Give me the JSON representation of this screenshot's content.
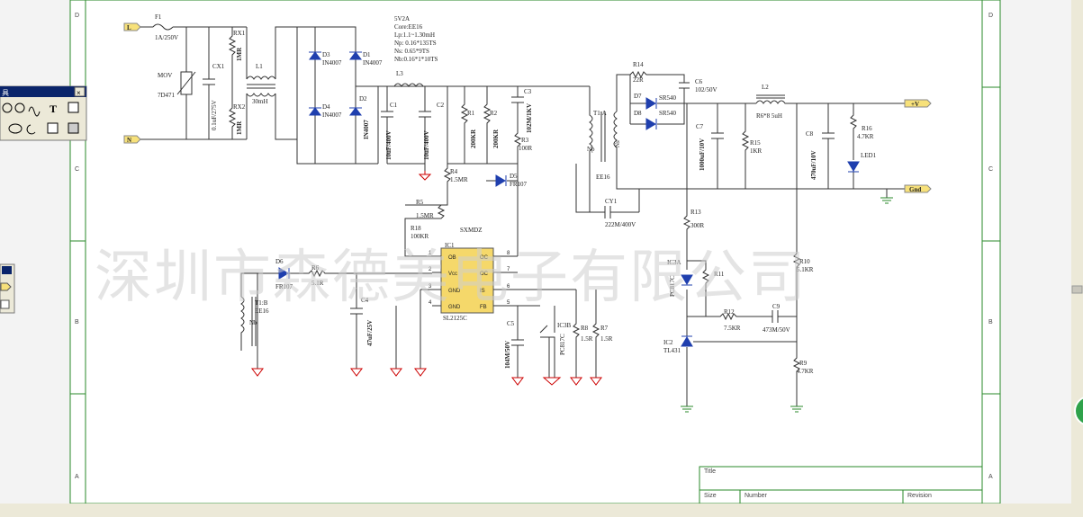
{
  "watermark": "深圳市森德美电子有限公司",
  "border_zones": {
    "left": [
      "D",
      "C",
      "B",
      "A"
    ],
    "right": [
      "D",
      "C",
      "B",
      "A"
    ]
  },
  "title_block": {
    "title_label": "Title",
    "size_label": "Size",
    "number_label": "Number",
    "revision_label": "Revision"
  },
  "toolbox": {
    "title": "具",
    "close": "×"
  },
  "nets": {
    "line": "L",
    "neutral": "N",
    "vout": "+V",
    "gnd": "Gnd"
  },
  "components": {
    "F1": [
      "F1",
      "1A/250V"
    ],
    "MOV": [
      "MOV",
      "7D471"
    ],
    "CX1": [
      "CX1",
      "0.1uF/275V"
    ],
    "RX1": [
      "RX1",
      "1MR"
    ],
    "RX2": [
      "RX2",
      "1MR"
    ],
    "L1": [
      "L1",
      "30mH"
    ],
    "D3": [
      "D3",
      "IN4007"
    ],
    "D1": [
      "D1",
      "IN4007"
    ],
    "D4": [
      "D4",
      "IN4007"
    ],
    "D2": [
      "D2",
      "IN4007"
    ],
    "C1": [
      "C1",
      "10uF/400V"
    ],
    "C2": [
      "C2",
      "10uF/400V"
    ],
    "L3": [
      "L3"
    ],
    "R1": [
      "R1",
      "200KR"
    ],
    "R2": [
      "R2",
      "200KR"
    ],
    "C3": [
      "C3",
      "102M/1KV"
    ],
    "R3": [
      "R3",
      "100R"
    ],
    "D5": [
      "D5",
      "FR107"
    ],
    "R4": [
      "R4",
      "1.5MR"
    ],
    "R5": [
      "R5",
      "1.5MR"
    ],
    "R18": [
      "R18",
      "100KR"
    ],
    "T1A": [
      "T1:A",
      "Np",
      "Ns",
      "EE16"
    ],
    "R14": [
      "R14",
      "22R"
    ],
    "C6": [
      "C6",
      "102/50V"
    ],
    "D7": [
      "D7",
      "SR540"
    ],
    "D8": [
      "D8",
      "SR540"
    ],
    "C7": [
      "C7",
      "1000uF/10V"
    ],
    "R15": [
      "R15",
      "1KR"
    ],
    "L2": [
      "L2",
      "R6*8 5uH"
    ],
    "C8": [
      "C8",
      "470uF/10V"
    ],
    "R16": [
      "R16",
      "4.7KR"
    ],
    "LED1": [
      "LED1"
    ],
    "CY1": [
      "CY1",
      "222M/400V"
    ],
    "R13": [
      "R13",
      "300R"
    ],
    "IC3A": [
      "IC3A",
      "PC817C"
    ],
    "R11": [
      "R11"
    ],
    "R10": [
      "R10",
      "5.1KR"
    ],
    "R12": [
      "R12",
      "7.5KR"
    ],
    "C9": [
      "C9",
      "473M/50V"
    ],
    "IC2": [
      "IC2",
      "TL431"
    ],
    "R9": [
      "R9",
      "4.7KR"
    ],
    "D6": [
      "D6",
      "FR107"
    ],
    "R6": [
      "R6",
      "5.1R"
    ],
    "T1B": [
      "T1:B",
      "EE16",
      "Nb"
    ],
    "C4": [
      "C4",
      "47uF/25V"
    ],
    "C5": [
      "C5",
      "104M/50V"
    ],
    "IC3B": [
      "IC3B",
      "PC817C"
    ],
    "R8": [
      "R8",
      "1.5R"
    ],
    "R7": [
      "R7",
      "1.5R"
    ]
  },
  "transformer_note": [
    "5V2A",
    "Core:EE16",
    "Lp:1.1~1.30mH",
    "Np: 0.16*135TS",
    "Ns: 0.65*9TS",
    "Nb:0.16*1*10TS"
  ],
  "ic1": {
    "ref": "IC1",
    "part_top": "SXMDZ",
    "part": "SL2125C",
    "pins_left": [
      [
        "1",
        "OB"
      ],
      [
        "2",
        "Vcc"
      ],
      [
        "3",
        "GND"
      ],
      [
        "4",
        "GND"
      ]
    ],
    "pins_right": [
      [
        "8",
        "OC"
      ],
      [
        "7",
        "OC"
      ],
      [
        "6",
        "IS"
      ],
      [
        "5",
        "FB"
      ]
    ]
  }
}
